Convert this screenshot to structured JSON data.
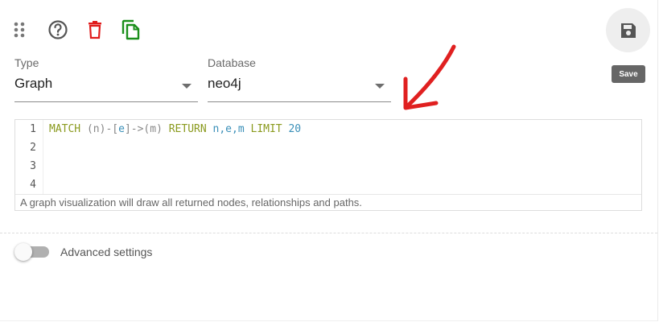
{
  "toolbar": {
    "drag_icon": "drag-handle-icon",
    "help_icon": "help-circle-icon",
    "delete_icon": "trash-icon",
    "duplicate_icon": "copy-icon",
    "delete_color": "#e01b1b",
    "duplicate_color": "#1a8f1a"
  },
  "type_field": {
    "label": "Type",
    "value": "Graph"
  },
  "database_field": {
    "label": "Database",
    "value": "neo4j"
  },
  "save": {
    "icon": "floppy-disk-icon",
    "tooltip": "Save"
  },
  "editor": {
    "line_numbers": [
      "1",
      "2",
      "3",
      "4"
    ],
    "tokens": {
      "match": "MATCH",
      "pattern_a": " (n)-[",
      "e": "e",
      "pattern_b": "]->(m) ",
      "return": "RETURN",
      "vars": " n,e,m ",
      "limit": "LIMIT",
      "num": " 20"
    },
    "help_text": "A graph visualization will draw all returned nodes, relationships and paths."
  },
  "advanced": {
    "label": "Advanced settings",
    "enabled": false
  },
  "annotation": {
    "color": "#e02020",
    "icon": "red-arrow-annotation"
  }
}
